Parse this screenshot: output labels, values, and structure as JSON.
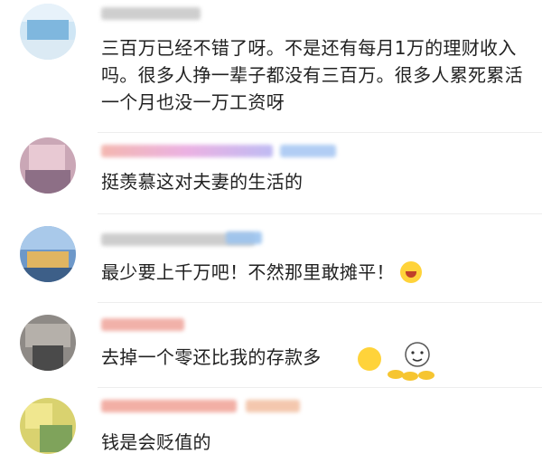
{
  "comments": [
    {
      "text": "三百万已经不错了呀。不是还有每月1万的理财收入吗。很多人挣一辈子都没有三百万。很多人累死累活一个月也没一万工资呀"
    },
    {
      "text": "挺羡慕这对夫妻的生活的"
    },
    {
      "text": "最少要上千万吧！不然那里敢摊平！",
      "emoji": "laughing-tears-icon"
    },
    {
      "text": "去掉一个零还比我的存款多",
      "emoji": "thinking-face-icon",
      "sticker": "money-cartoon-sticker"
    },
    {
      "text": "钱是会贬值的"
    }
  ],
  "colors": {
    "text": "#222222",
    "divider": "#ededed",
    "emoji": "#ffd33a"
  }
}
